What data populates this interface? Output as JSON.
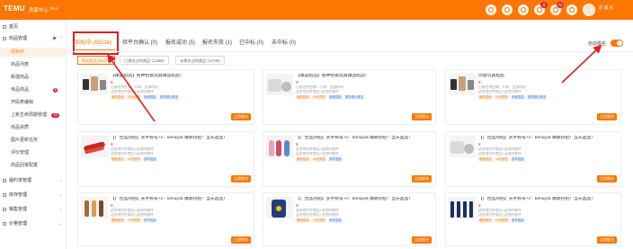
{
  "header": {
    "logo": "TEMU",
    "subtitle": "卖家中心",
    "beta": "Beta",
    "badge_a": "0",
    "badge_b": "72",
    "shop_line1": "",
    "shop_line2": "店 铺 名"
  },
  "sidebar": {
    "items": [
      {
        "label": "首页",
        "type": "group"
      },
      {
        "label": "商品管理",
        "type": "group"
      },
      {
        "label": "招标中",
        "type": "item",
        "active": true
      },
      {
        "label": "商品列表",
        "type": "item"
      },
      {
        "label": "新建商品",
        "type": "item"
      },
      {
        "label": "待品商品",
        "type": "item",
        "dot": "4"
      },
      {
        "label": "开码表编辑",
        "type": "item"
      },
      {
        "label": "上新生命周期管理",
        "type": "item",
        "pill": "12"
      },
      {
        "label": "商品资质",
        "type": "item"
      },
      {
        "label": "图片更新任务",
        "type": "item"
      },
      {
        "label": "评价管理",
        "type": "item"
      },
      {
        "label": "商品回答配置",
        "type": "item"
      },
      {
        "label": "履约单管理",
        "type": "group"
      },
      {
        "label": "库存管理",
        "type": "group"
      },
      {
        "label": "销售管理",
        "type": "group"
      },
      {
        "label": "价格管理",
        "type": "group"
      }
    ]
  },
  "tabs": {
    "items": [
      "招标中 (65516)",
      "待平台确认 (0)",
      "报名成功 (5)",
      "报名失败 (1)",
      "已中标 (0)",
      "未中标 (0)"
    ],
    "active_index": 0
  },
  "subtabs": [
    "报名机会 (55171)",
    "已报名过的商品 (11366)",
    "未报名过的商品 (12748)"
  ],
  "auto_signup_label": "自动报名",
  "cards": {
    "action_label": "立即报名",
    "title_generic": "【广告品热招】买手称号+v：temuyoli 爆款热招！当天选品！",
    "title_a": "【爆品招品】各种创意玩具爆品招品！",
    "title_b": "【爆品招品】各种创意玩具爆品招品！",
    "title_c": "创意玩具招品",
    "price": "¥:",
    "line_a": "已报名供应商：0·周：全部时间",
    "line_b": "适合地方件商品+适合时装件",
    "tag1": "爆品招品",
    "tag2": "10天质检",
    "tag3": "多维招选",
    "tag4": "更多预计报名",
    "tag5": "多件招品"
  }
}
